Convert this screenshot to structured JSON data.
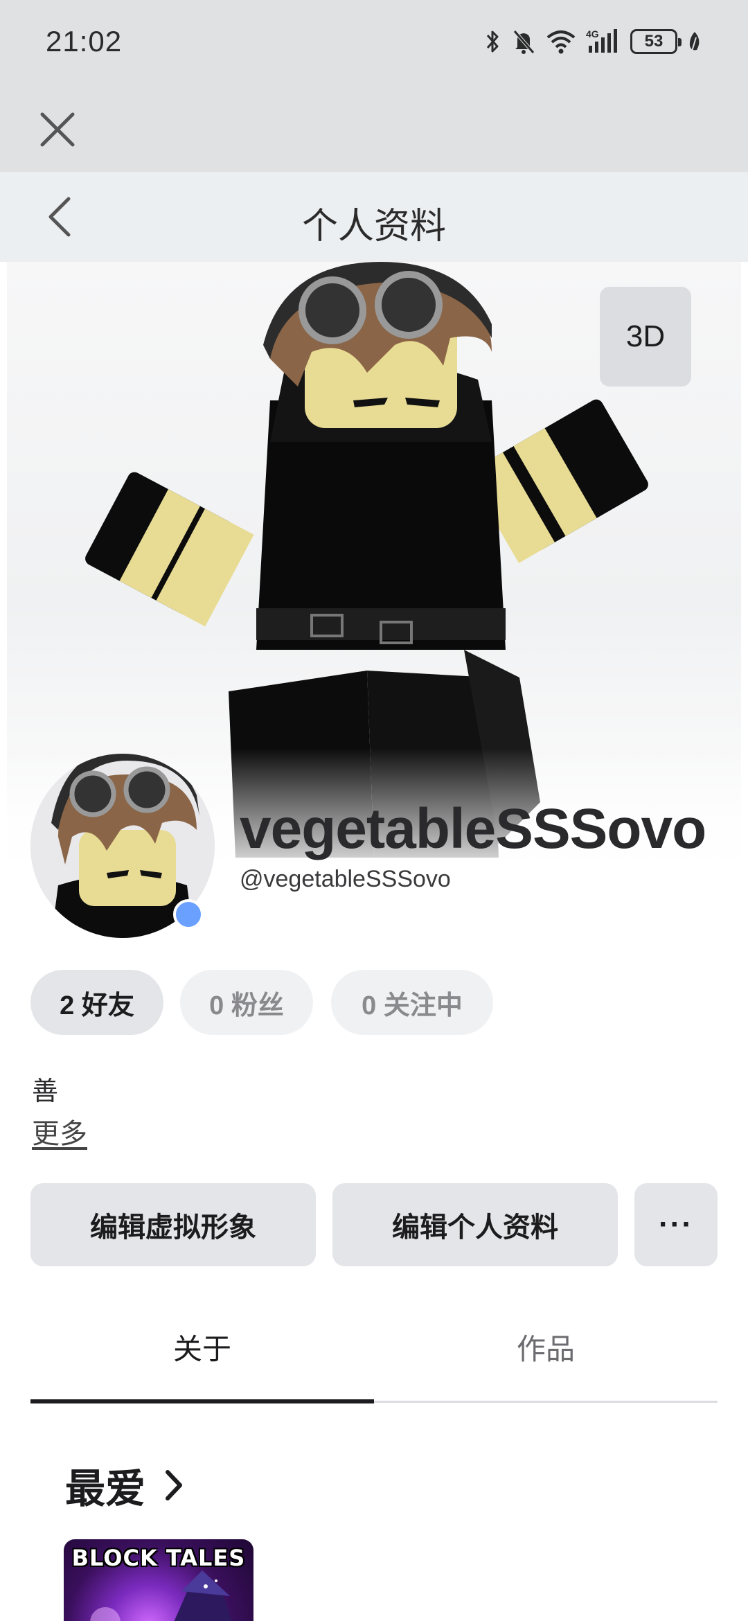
{
  "status_bar": {
    "time": "21:02",
    "battery": "53",
    "network": "4G",
    "icons": [
      "bluetooth-icon",
      "bell-muted-icon",
      "wifi-icon",
      "signal-icon",
      "battery-icon",
      "leaf-icon"
    ]
  },
  "header": {
    "title": "个人资料"
  },
  "hero": {
    "view_3d_label": "3D"
  },
  "profile": {
    "display_name": "vegetableSSSovo",
    "username": "@vegetableSSSovo",
    "online": true,
    "status_color": "#6aa0ff"
  },
  "stats": {
    "friends": "2 好友",
    "followers": "0 粉丝",
    "following": "0 关注中"
  },
  "bio": {
    "text": "善",
    "more_label": "更多"
  },
  "actions": {
    "edit_avatar": "编辑虚拟形象",
    "edit_profile": "编辑个人资料",
    "more": "···"
  },
  "tabs": [
    {
      "label": "关于",
      "active": true
    },
    {
      "label": "作品",
      "active": false
    }
  ],
  "favorites": {
    "title": "最爱",
    "items": [
      {
        "name": "BLOCK TALES"
      }
    ]
  }
}
